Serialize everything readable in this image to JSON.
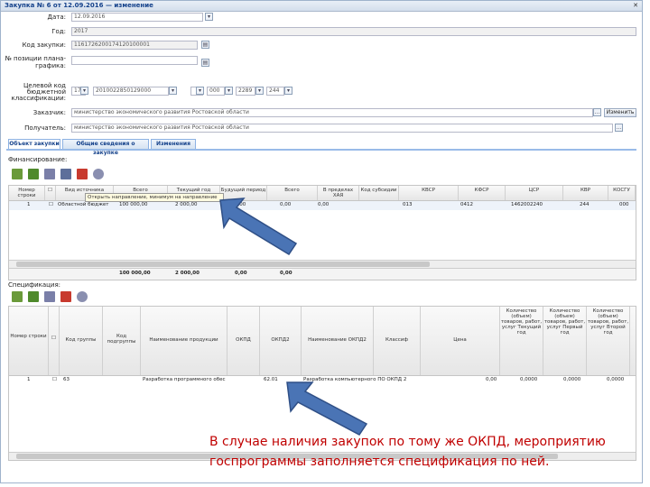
{
  "window": {
    "title": "Закупка № 6 от 12.09.2016 — изменение"
  },
  "form": {
    "date_label": "Дата:",
    "date_value": "12.09.2016",
    "year_label": "Год:",
    "year_value": "2017",
    "code_label": "Код закупки:",
    "code_value": "1161726200174120100001",
    "pos_label": "№ позиции плана-графика:",
    "pos_value": "",
    "kbk_label": "Целевой код бюджетной классификации:",
    "kbk_parts": [
      "17",
      "2010022850129000",
      "",
      "000",
      "2289",
      "244"
    ],
    "zak_label": "Заказчик:",
    "zak_value": "министерство экономического развития Ростовской области",
    "pol_label": "Получатель:",
    "pol_value": "министерство экономического развития Ростовской области",
    "change_label": "Изменить"
  },
  "tabs": [
    "Объект закупки",
    "Общие сведения о закупке",
    "Изменения"
  ],
  "financing": {
    "title": "Финансирование:",
    "headers": [
      "Номер строки",
      "Вид источника",
      "Всего",
      "Текущий год",
      "Будущий период",
      "Всего",
      "В пределах ХАЯ",
      "Код субсидии",
      "КВСР",
      "КФСР",
      "ЦСР",
      "КВР",
      "КОСГУ"
    ],
    "tooltip": "Открыть направление, минимум на направление",
    "row": [
      "1",
      "Областной бюджет",
      "100 000,00",
      "2 000,00",
      "0,00",
      "0,00",
      "0,00",
      "",
      "013",
      "0412",
      "1462002240",
      "244",
      "000"
    ],
    "totals": [
      "100 000,00",
      "2 000,00",
      "0,00",
      "0,00"
    ]
  },
  "spec": {
    "title": "Спецификация:",
    "headers": [
      "Номер строки",
      "Код группы",
      "Код подгруппы",
      "Наименование продукции",
      "ОКПД",
      "ОКПД2",
      "Наименование ОКПД2",
      "Классиф",
      "Цена",
      "Количество (объем) товаров, работ, услуг Текущий год",
      "Количество (объем) товаров, работ, услуг Первый год",
      "Количество (объем) товаров, работ, услуг Второй год"
    ],
    "row": [
      "1",
      "63",
      "",
      "Разработка программного обеспечения",
      "",
      "62.01",
      "Разработка компьютерного ПО ОКПД 2",
      "",
      "0,00",
      "0,0000",
      "0,0000",
      "0,0000"
    ]
  },
  "caption": "В случае наличия закупок по тому же ОКПД, мероприятию госпрограммы заполняется спецификация по ней.",
  "colors": {
    "arrow": "#4a74b5",
    "caption": "#c00000",
    "tab_border": "#99bbe8"
  }
}
